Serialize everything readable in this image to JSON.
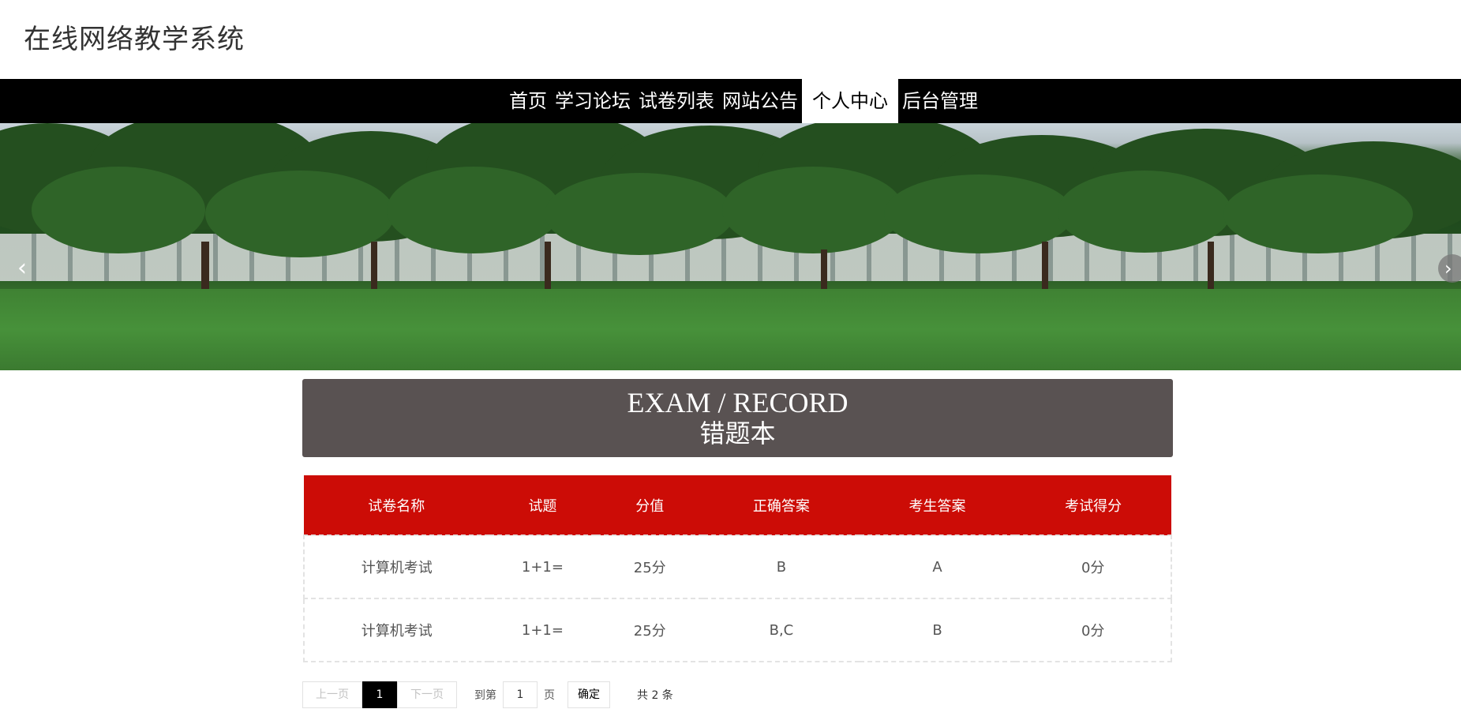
{
  "site": {
    "title": "在线网络教学系统"
  },
  "nav": {
    "items": [
      {
        "label": "首页",
        "active": false
      },
      {
        "label": "学习论坛",
        "active": false
      },
      {
        "label": "试卷列表",
        "active": false
      },
      {
        "label": "网站公告",
        "active": false
      },
      {
        "label": "个人中心",
        "active": true
      },
      {
        "label": "后台管理",
        "active": false
      }
    ]
  },
  "carousel": {
    "prev_icon": "chevron-left-icon",
    "next_icon": "chevron-right-icon"
  },
  "record_header": {
    "english": "EXAM / RECORD",
    "chinese": "错题本"
  },
  "table": {
    "columns": [
      "试卷名称",
      "试题",
      "分值",
      "正确答案",
      "考生答案",
      "考试得分"
    ],
    "rows": [
      [
        "计算机考试",
        "1+1=",
        "25分",
        "B",
        "A",
        "0分"
      ],
      [
        "计算机考试",
        "1+1=",
        "25分",
        "B,C",
        "B",
        "0分"
      ]
    ]
  },
  "pagination": {
    "prev_label": "上一页",
    "current_page": "1",
    "next_label": "下一页",
    "goto_label": "到第",
    "goto_value": "1",
    "page_unit": "页",
    "confirm_label": "确定",
    "total_label": "共 2 条"
  },
  "colors": {
    "nav_background": "#000000",
    "header_band": "#595252",
    "table_header": "#cc0c06",
    "page_current": "#000000"
  }
}
